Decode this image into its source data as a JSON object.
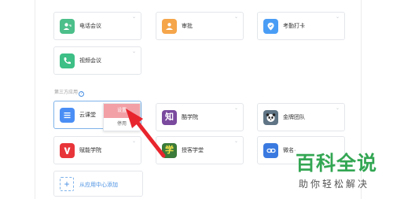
{
  "apps_top": [
    {
      "label": "电话会议",
      "icon": "phone-person-icon",
      "color": "#4cbf8a"
    },
    {
      "label": "审批",
      "icon": "approval-person-icon",
      "color": "#f5a54a"
    },
    {
      "label": "考勤打卡",
      "icon": "location-pin-icon",
      "color": "#4a9df5"
    },
    {
      "label": "视频会议",
      "icon": "video-phone-icon",
      "color": "#3dbf86"
    }
  ],
  "third_party": {
    "section_label": "第三方应用",
    "help_glyph": "?",
    "apps": [
      {
        "label": "云课堂",
        "icon": "menu-lines-icon",
        "color": "#4a8ef5"
      },
      {
        "label": "酷学院",
        "icon": "zhi-glyph-icon",
        "glyph": "知",
        "color": "#7a4a9e"
      },
      {
        "label": "金牌团队",
        "icon": "panda-icon",
        "color": "#5f7585"
      },
      {
        "label": "赋能学院",
        "icon": "v-shield-icon",
        "color": "#e8353a"
      },
      {
        "label": "授客学堂",
        "icon": "xue-glyph-icon",
        "glyph": "学",
        "color": "#3a7a3a"
      },
      {
        "label": "微名·",
        "icon": "chain-link-icon",
        "color": "#3a7ae0"
      }
    ],
    "context_menu": {
      "item_primary": "设置",
      "item_secondary": "停用"
    }
  },
  "add_from_center": {
    "label": "从应用中心添加",
    "icon": "plus-icon",
    "glyph": "+"
  },
  "more_glyph": "⌄",
  "watermark": {
    "title": "百科全说",
    "subtitle": "助你轻松解决",
    "color": "#33a653"
  },
  "colors": {
    "accent": "#4a90e2",
    "arrow": "#e8252d",
    "menu_highlight": "#f2a0a6"
  }
}
